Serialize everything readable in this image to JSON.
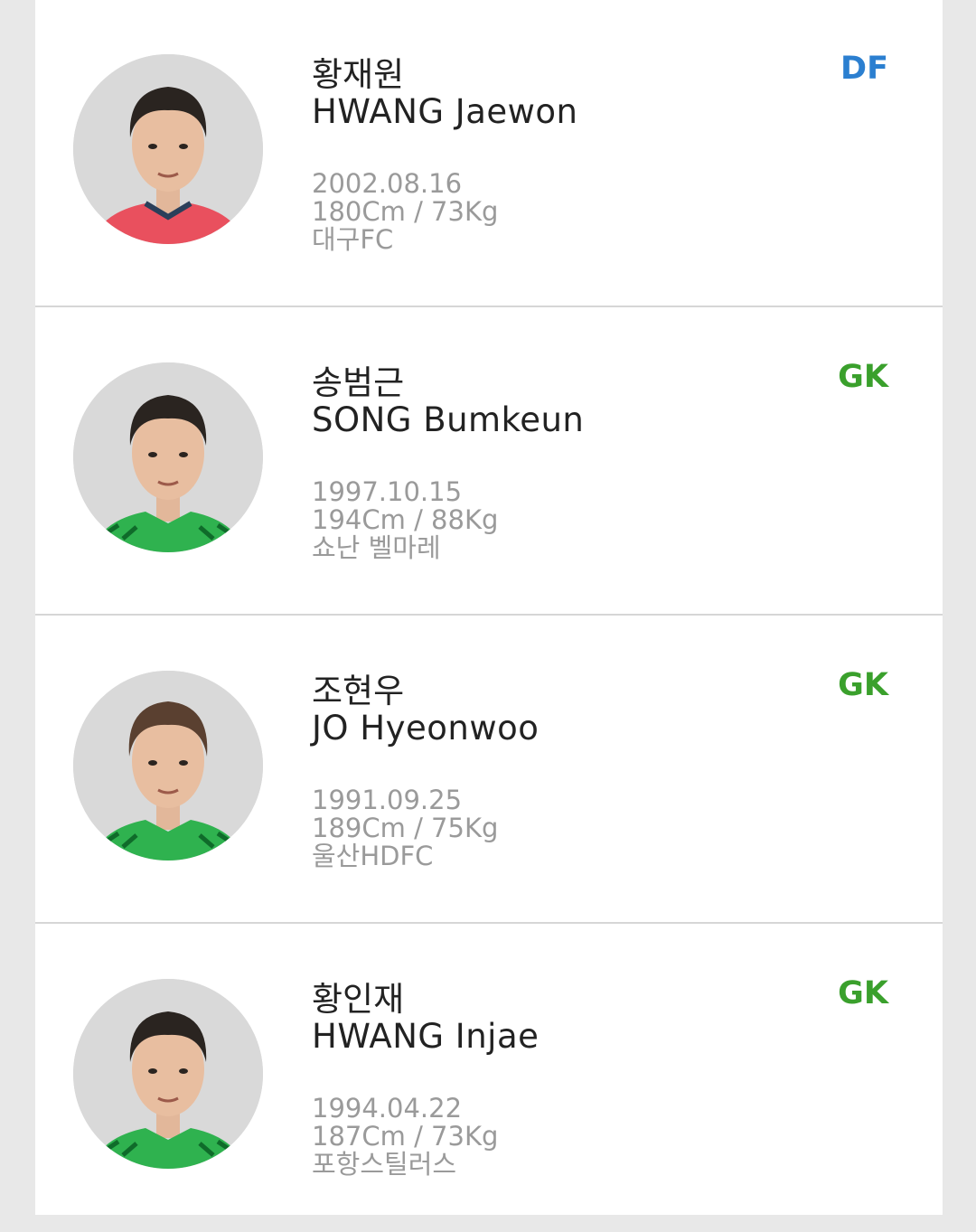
{
  "players": [
    {
      "name_ko": "황재원",
      "name_en": "HWANG Jaewon",
      "birth": "2002.08.16",
      "body": "180Cm / 73Kg",
      "club": "대구FC",
      "position": "DF",
      "position_color": "#2b7fd0",
      "jersey_color": "#e9505e",
      "photo": "player-photo"
    },
    {
      "name_ko": "송범근",
      "name_en": "SONG Bumkeun",
      "birth": "1997.10.15",
      "body": "194Cm / 88Kg",
      "club": "쇼난 벨마레",
      "position": "GK",
      "position_color": "#3aa02c",
      "jersey_color": "#2fb24f",
      "photo": "player-photo"
    },
    {
      "name_ko": "조현우",
      "name_en": "JO Hyeonwoo",
      "birth": "1991.09.25",
      "body": "189Cm / 75Kg",
      "club": "울산HDFC",
      "position": "GK",
      "position_color": "#3aa02c",
      "jersey_color": "#2fb24f",
      "photo": "player-photo"
    },
    {
      "name_ko": "황인재",
      "name_en": "HWANG Injae",
      "birth": "1994.04.22",
      "body": "187Cm / 73Kg",
      "club": "포항스틸러스",
      "position": "GK",
      "position_color": "#3aa02c",
      "jersey_color": "#2fb24f",
      "photo": "player-photo"
    }
  ]
}
